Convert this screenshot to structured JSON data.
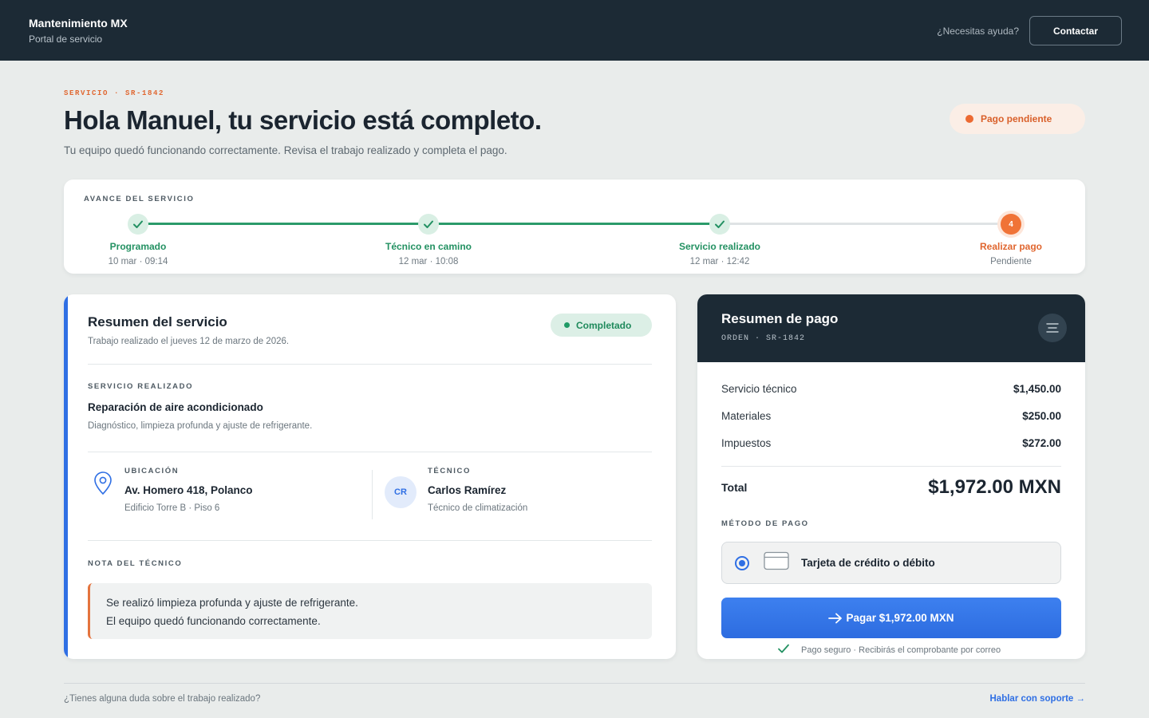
{
  "header": {
    "brand_name": "Mantenimiento MX",
    "brand_subtitle": "Portal de servicio",
    "help_text": "¿Necesitas ayuda?",
    "contact_label": "Contactar"
  },
  "hero": {
    "eyebrow": "SERVICIO · SR-1842",
    "title": "Hola Manuel, tu servicio está completo.",
    "subtitle": "Tu equipo quedó funcionando correctamente. Revisa el trabajo realizado y completa el pago.",
    "status_pill": "Pago pendiente"
  },
  "progress": {
    "label": "AVANCE DEL SERVICIO",
    "steps": [
      {
        "name": "Programado",
        "date": "10 mar · 09:14",
        "state": "done"
      },
      {
        "name": "Técnico en camino",
        "date": "12 mar · 10:08",
        "state": "done"
      },
      {
        "name": "Servicio realizado",
        "date": "12 mar · 12:42",
        "state": "done"
      },
      {
        "name": "Realizar pago",
        "date": "Pendiente",
        "state": "active",
        "number": "4"
      }
    ]
  },
  "service": {
    "title": "Resumen del servicio",
    "subtitle": "Trabajo realizado el jueves 12 de marzo de 2026.",
    "status": "Completado",
    "done_label": "SERVICIO REALIZADO",
    "name": "Reparación de aire acondicionado",
    "description": "Diagnóstico, limpieza profunda y ajuste de refrigerante.",
    "location_label": "UBICACIÓN",
    "location_name": "Av. Homero 418, Polanco",
    "location_detail": "Edificio Torre B · Piso 6",
    "tech_label": "TÉCNICO",
    "tech_initials": "CR",
    "tech_name": "Carlos Ramírez",
    "tech_role": "Técnico de climatización",
    "note_label": "NOTA DEL TÉCNICO",
    "note_line1": "Se realizó limpieza profunda y ajuste de refrigerante.",
    "note_line2": "El equipo quedó funcionando correctamente."
  },
  "payment": {
    "title": "Resumen de pago",
    "order": "ORDEN · SR-1842",
    "items": [
      {
        "label": "Servicio técnico",
        "amount": "$1,450.00"
      },
      {
        "label": "Materiales",
        "amount": "$250.00"
      },
      {
        "label": "Impuestos",
        "amount": "$272.00"
      }
    ],
    "total_label": "Total",
    "total_amount": "$1,972.00 MXN",
    "method_label": "MÉTODO DE PAGO",
    "method_name": "Tarjeta de crédito o débito",
    "pay_label": "Pagar $1,972.00 MXN",
    "secure_text": "Pago seguro · Recibirás el comprobante por correo"
  },
  "footer": {
    "question": "¿Tienes alguna duda sobre el trabajo realizado?",
    "support_link": "Hablar con soporte →"
  },
  "colors": {
    "navy": "#1c2a35",
    "accent_orange": "#e0662f",
    "success_green": "#239162",
    "primary_blue": "#2f6fe4"
  }
}
